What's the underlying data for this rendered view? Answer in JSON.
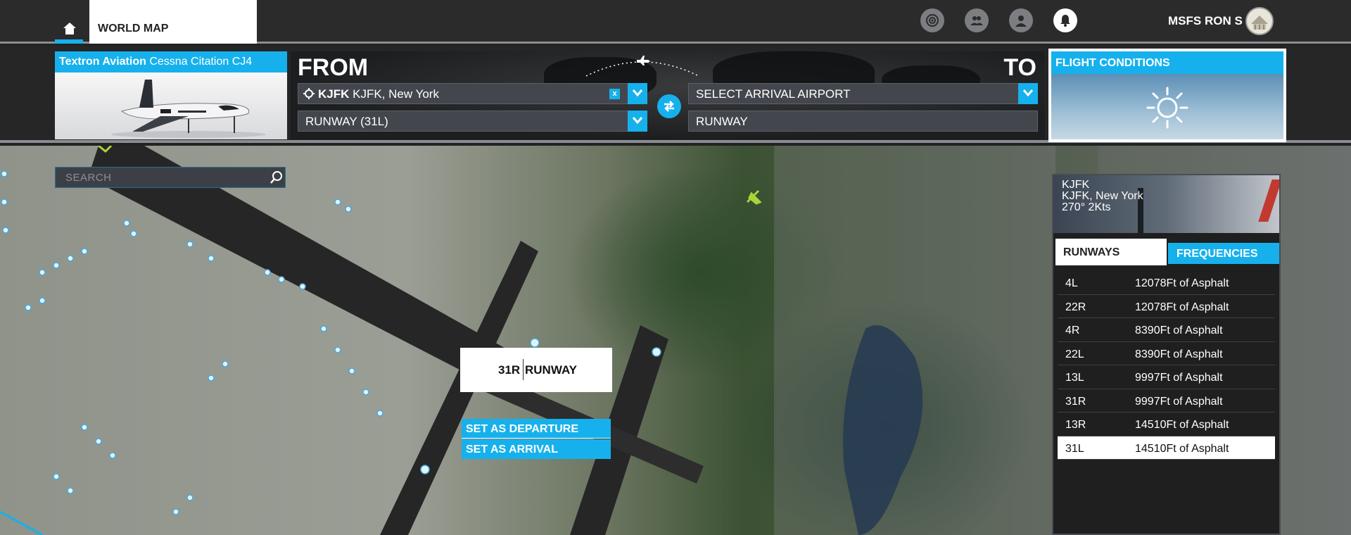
{
  "nav": {
    "world_map": "WORLD MAP",
    "username": "MSFS RON S"
  },
  "aircraft": {
    "maker": "Textron Aviation",
    "model": "Cessna Citation CJ4"
  },
  "route": {
    "from_label": "FROM",
    "to_label": "TO",
    "departure_code": "KJFK",
    "departure_name": "KJFK, New York",
    "departure_clear": "x",
    "departure_runway": "RUNWAY (31L)",
    "arrival_placeholder": "SELECT ARRIVAL AIRPORT",
    "arrival_runway": "RUNWAY"
  },
  "conditions": {
    "title": "FLIGHT CONDITIONS",
    "icon": "sun-icon"
  },
  "search": {
    "placeholder": "SEARCH"
  },
  "runway_popup": {
    "id": "31R",
    "label": "RUNWAY",
    "set_departure": "SET AS DEPARTURE",
    "set_arrival": "SET AS ARRIVAL"
  },
  "airport": {
    "icao": "KJFK",
    "name": "KJFK, New York",
    "wind": "270° 2Kts",
    "tabs": {
      "runways": "RUNWAYS",
      "frequencies": "FREQUENCIES"
    },
    "runways": [
      {
        "id": "4L",
        "length": "12078Ft of Asphalt"
      },
      {
        "id": "22R",
        "length": "12078Ft of Asphalt"
      },
      {
        "id": "4R",
        "length": "8390Ft of Asphalt"
      },
      {
        "id": "22L",
        "length": "8390Ft of Asphalt"
      },
      {
        "id": "13L",
        "length": "9997Ft of Asphalt"
      },
      {
        "id": "31R",
        "length": "9997Ft of Asphalt"
      },
      {
        "id": "13R",
        "length": "14510Ft of Asphalt"
      },
      {
        "id": "31L",
        "length": "14510Ft of Asphalt"
      }
    ],
    "selected_runway": "31L"
  },
  "colors": {
    "accent": "#16b1ec",
    "bar": "#2b2b2c",
    "field": "#43474d"
  }
}
